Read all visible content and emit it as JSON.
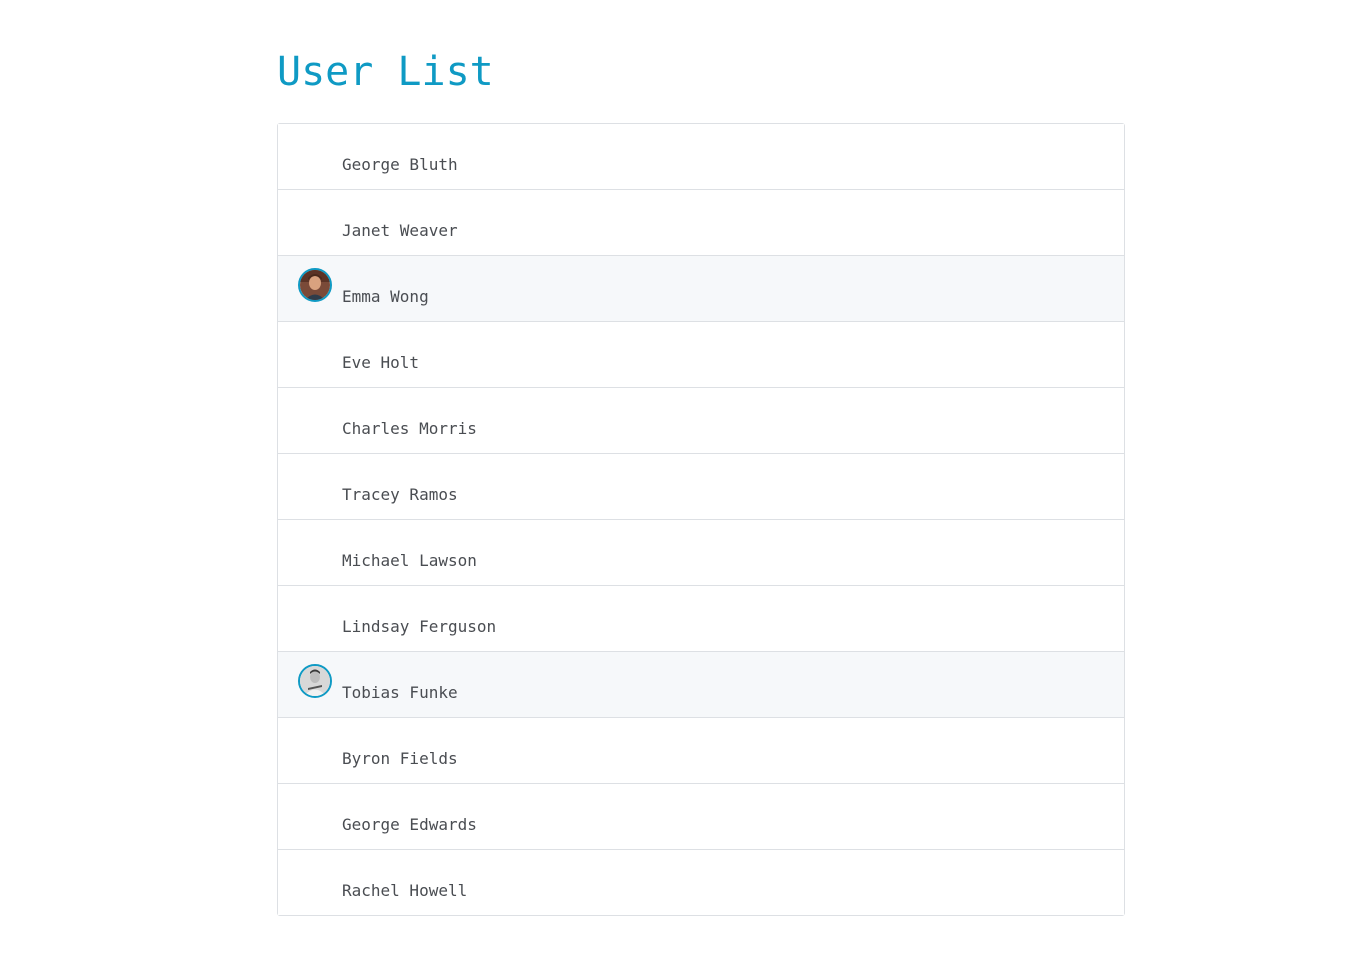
{
  "page": {
    "title": "User List"
  },
  "theme": {
    "accent": "#0f9ac4",
    "text": "#4a4d52",
    "border": "#dde0e4",
    "highlight_bg": "#f6f8fa"
  },
  "users": [
    {
      "name": "George Bluth",
      "highlighted": false,
      "avatar": null
    },
    {
      "name": "Janet Weaver",
      "highlighted": false,
      "avatar": null
    },
    {
      "name": "Emma Wong",
      "highlighted": true,
      "avatar": "avatar-photo-emma"
    },
    {
      "name": "Eve Holt",
      "highlighted": false,
      "avatar": null
    },
    {
      "name": "Charles Morris",
      "highlighted": false,
      "avatar": null
    },
    {
      "name": "Tracey Ramos",
      "highlighted": false,
      "avatar": null
    },
    {
      "name": "Michael Lawson",
      "highlighted": false,
      "avatar": null
    },
    {
      "name": "Lindsay Ferguson",
      "highlighted": false,
      "avatar": null
    },
    {
      "name": "Tobias Funke",
      "highlighted": true,
      "avatar": "avatar-photo-tobias"
    },
    {
      "name": "Byron Fields",
      "highlighted": false,
      "avatar": null
    },
    {
      "name": "George Edwards",
      "highlighted": false,
      "avatar": null
    },
    {
      "name": "Rachel Howell",
      "highlighted": false,
      "avatar": null
    }
  ]
}
